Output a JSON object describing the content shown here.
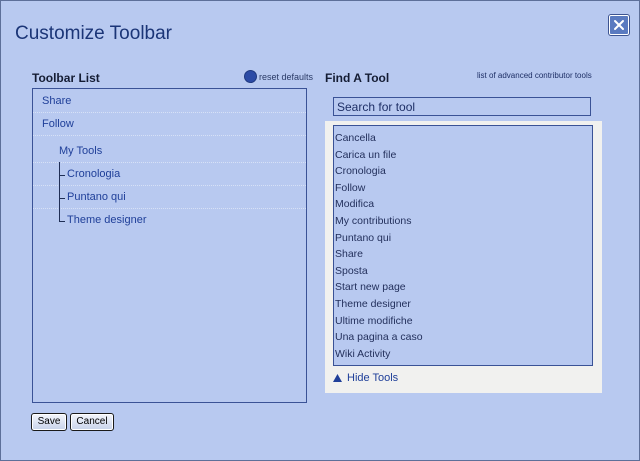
{
  "dialog": {
    "title": "Customize Toolbar",
    "close_icon": "close-x-icon"
  },
  "toolbar_list": {
    "heading": "Toolbar List",
    "reset_label": "reset defaults",
    "items": [
      {
        "label": "Share"
      },
      {
        "label": "Follow"
      },
      {
        "label": "My Tools"
      },
      {
        "label": "Cronologia"
      },
      {
        "label": "Puntano qui"
      },
      {
        "label": "Theme designer"
      }
    ]
  },
  "find_tool": {
    "heading": "Find A Tool",
    "advanced_link": "list of advanced contributor tools",
    "search_placeholder": "Search for tool",
    "tools": [
      "Cancella",
      "Carica un file",
      "Cronologia",
      "Follow",
      "Modifica",
      "My contributions",
      "Puntano qui",
      "Share",
      "Sposta",
      "Start new page",
      "Theme designer",
      "Ultime modifiche",
      "Una pagina a caso",
      "Wiki Activity"
    ],
    "hide_tools_label": "Hide Tools"
  },
  "buttons": {
    "save": "Save",
    "cancel": "Cancel"
  },
  "colors": {
    "dialog_bg": "#b8c9f0",
    "title": "#1b3577",
    "link": "#1f3f99",
    "border": "#3a5296"
  }
}
